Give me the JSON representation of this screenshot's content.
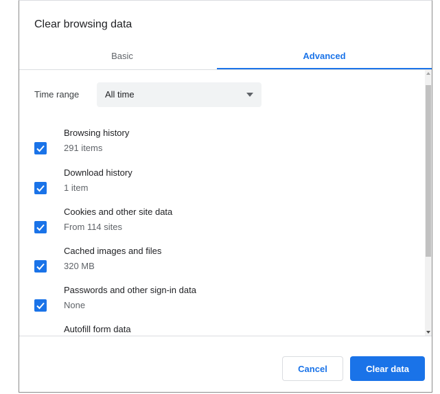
{
  "dialog": {
    "title": "Clear browsing data"
  },
  "tabs": [
    {
      "label": "Basic",
      "selected": false
    },
    {
      "label": "Advanced",
      "selected": true
    }
  ],
  "time_range": {
    "label": "Time range",
    "value": "All time"
  },
  "items": [
    {
      "label": "Browsing history",
      "detail": "291 items",
      "checked": true
    },
    {
      "label": "Download history",
      "detail": "1 item",
      "checked": true
    },
    {
      "label": "Cookies and other site data",
      "detail": "From 114 sites",
      "checked": true
    },
    {
      "label": "Cached images and files",
      "detail": "320 MB",
      "checked": true
    },
    {
      "label": "Passwords and other sign-in data",
      "detail": "None",
      "checked": true
    },
    {
      "label": "Autofill form data",
      "detail": "",
      "checked": true
    }
  ],
  "footer": {
    "cancel_label": "Cancel",
    "clear_label": "Clear data"
  },
  "colors": {
    "accent": "#1a73e8",
    "select_bg": "#f1f3f4",
    "divider": "#dadce0"
  }
}
